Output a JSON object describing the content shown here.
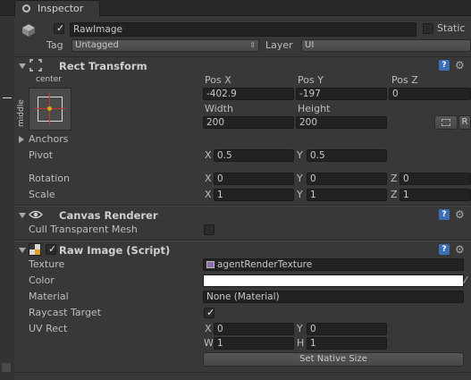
{
  "tab": {
    "title": "Inspector"
  },
  "header": {
    "name": "RawImage",
    "static_label": "Static",
    "tag_label": "Tag",
    "tag_value": "Untagged",
    "layer_label": "Layer",
    "layer_value": "UI"
  },
  "rect_transform": {
    "title": "Rect Transform",
    "anchor_h": "center",
    "anchor_v": "middle",
    "headers": {
      "posx": "Pos X",
      "posy": "Pos Y",
      "posz": "Pos Z",
      "width": "Width",
      "height": "Height"
    },
    "posx": "-402.9",
    "posy": "-197",
    "posz": "0",
    "width": "200",
    "height": "200",
    "r_button": "R",
    "anchors_label": "Anchors",
    "pivot_label": "Pivot",
    "pivot_x": "0.5",
    "pivot_y": "0.5",
    "rotation_label": "Rotation",
    "rot_x": "0",
    "rot_y": "0",
    "rot_z": "0",
    "scale_label": "Scale",
    "scale_x": "1",
    "scale_y": "1",
    "scale_z": "1",
    "axis_x": "X",
    "axis_y": "Y",
    "axis_z": "Z"
  },
  "canvas_renderer": {
    "title": "Canvas Renderer",
    "cull_label": "Cull Transparent Mesh"
  },
  "raw_image": {
    "title": "Raw Image (Script)",
    "texture_label": "Texture",
    "texture_value": "agentRenderTexture",
    "color_label": "Color",
    "color_value": "#ffffff",
    "material_label": "Material",
    "material_value": "None (Material)",
    "raycast_label": "Raycast Target",
    "uvrect_label": "UV Rect",
    "uv_x": "0",
    "uv_y": "0",
    "uv_w": "1",
    "uv_h": "1",
    "axis_w": "W",
    "axis_h": "H",
    "native_size_button": "Set Native Size"
  }
}
